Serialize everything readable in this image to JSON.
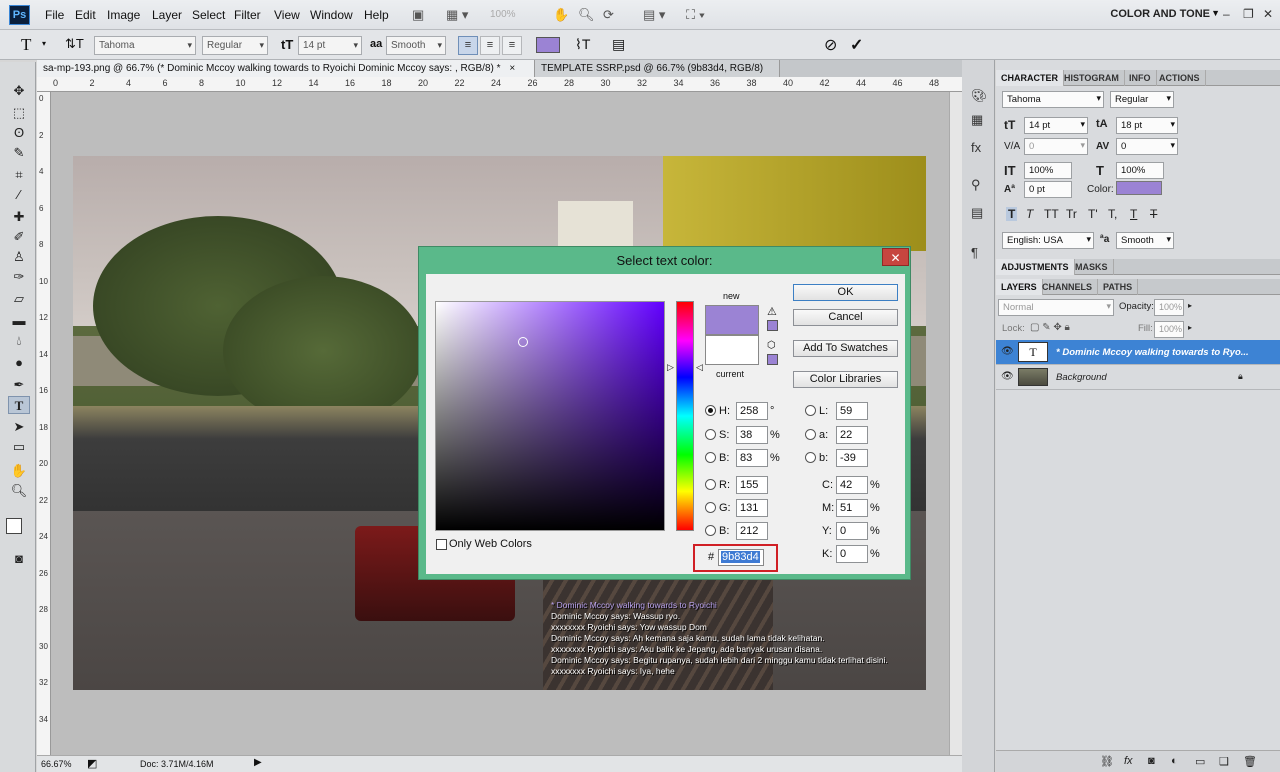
{
  "app": {
    "logo": "Ps",
    "menus": [
      "File",
      "Edit",
      "Image",
      "Layer",
      "Select",
      "Filter",
      "View",
      "Window",
      "Help"
    ],
    "zoom_menu": "100%",
    "workspace": "COLOR AND TONE"
  },
  "options": {
    "font_family": "Tahoma",
    "font_style": "Regular",
    "font_size": "14 pt",
    "aa_label": "a",
    "antialias": "Smooth",
    "text_color": "#9b83d4"
  },
  "tabs": [
    {
      "label": "sa-mp-193.png @ 66.7% (* Dominic Mccoy walking towards to Ryoichi Dominic Mccoy says: , RGB/8) *",
      "close": "×"
    },
    {
      "label": "TEMPLATE SSRP.psd @ 66.7% (9b83d4, RGB/8)",
      "close": "×"
    }
  ],
  "ruler": [
    "0",
    "2",
    "4",
    "6",
    "8",
    "10",
    "12",
    "14",
    "16",
    "18",
    "20",
    "22",
    "24",
    "26",
    "28",
    "30",
    "32",
    "34",
    "36",
    "38",
    "40",
    "42",
    "44",
    "46",
    "48"
  ],
  "status": {
    "zoom": "66.67%",
    "doc": "Doc: 3.71M/4.16M"
  },
  "chat": [
    {
      "text": "* Dominic Mccoy walking towards to Ryoichi",
      "color": "#b9a2ee"
    },
    {
      "text": "Dominic Mccoy says: Wassup ryo.",
      "color": "#ffffff"
    },
    {
      "text": "xxxxxxxx Ryoichi says: Yow wassup Dom",
      "color": "#ffffff"
    },
    {
      "text": "Dominic Mccoy says: Ah kemana saja kamu, sudah lama tidak kelihatan.",
      "color": "#ffffff"
    },
    {
      "text": "xxxxxxxx Ryoichi says: Aku balik ke Jepang, ada banyak urusan disana.",
      "color": "#ffffff"
    },
    {
      "text": "Dominic Mccoy says: Begitu rupanya, sudah lebih dari 2 minggu kamu tidak terlihat disini.",
      "color": "#ffffff"
    },
    {
      "text": "xxxxxxxx Ryoichi says: Iya, hehe",
      "color": "#ffffff"
    }
  ],
  "dialog": {
    "title": "Select text color:",
    "close": "✕",
    "new_label": "new",
    "current_label": "current",
    "new_color": "#9b83d4",
    "current_color": "#ffffff",
    "ok": "OK",
    "cancel": "Cancel",
    "add_swatches": "Add To Swatches",
    "color_libraries": "Color Libraries",
    "only_web": "Only Web Colors",
    "H": {
      "label": "H:",
      "value": "258",
      "unit": "°"
    },
    "S": {
      "label": "S:",
      "value": "38",
      "unit": "%"
    },
    "B": {
      "label": "B:",
      "value": "83",
      "unit": "%"
    },
    "R": {
      "label": "R:",
      "value": "155"
    },
    "G": {
      "label": "G:",
      "value": "131"
    },
    "Bl": {
      "label": "B:",
      "value": "212"
    },
    "L": {
      "label": "L:",
      "value": "59"
    },
    "a": {
      "label": "a:",
      "value": "22"
    },
    "b": {
      "label": "b:",
      "value": "-39"
    },
    "C": {
      "label": "C:",
      "value": "42",
      "unit": "%"
    },
    "M": {
      "label": "M:",
      "value": "51",
      "unit": "%"
    },
    "Y": {
      "label": "Y:",
      "value": "0",
      "unit": "%"
    },
    "K": {
      "label": "K:",
      "value": "0",
      "unit": "%"
    },
    "hash": "#",
    "hex": "9b83d4"
  },
  "panels": {
    "tabs1": [
      "CHARACTER",
      "HISTOGRAM",
      "INFO",
      "ACTIONS"
    ],
    "font_family": "Tahoma",
    "font_style": "Regular",
    "size": "14 pt",
    "leading": "18 pt",
    "kerning": "0",
    "tracking": "0",
    "vscale": "100%",
    "hscale": "100%",
    "baseline": "0 pt",
    "color_label": "Color:",
    "color": "#9b83d4",
    "styles": [
      "T",
      "T",
      "TT",
      "Tr",
      "T'",
      "T,",
      "T",
      "T"
    ],
    "language": "English: USA",
    "aa": "Smooth",
    "tabs2": [
      "ADJUSTMENTS",
      "MASKS"
    ],
    "tabs3": [
      "LAYERS",
      "CHANNELS",
      "PATHS"
    ],
    "blend": "Normal",
    "opacity_label": "Opacity:",
    "opacity": "100%",
    "lock_label": "Lock:",
    "fill_label": "Fill:",
    "fill": "100%",
    "layers": [
      {
        "name": "* Dominic Mccoy walking towards to Ryo...",
        "type": "T",
        "selected": true
      },
      {
        "name": "Background",
        "type": "img",
        "selected": false
      }
    ]
  }
}
